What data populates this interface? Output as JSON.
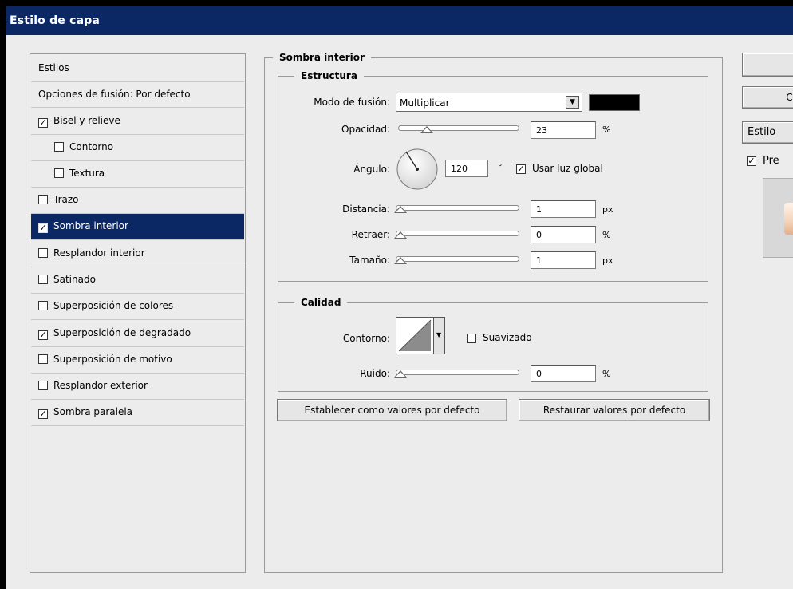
{
  "window": {
    "title": "Estilo de capa"
  },
  "sidebar": {
    "items": [
      {
        "label": "Estilos",
        "checkbox": false,
        "checked": false,
        "selected": false,
        "indent": false
      },
      {
        "label": "Opciones de fusión: Por defecto",
        "checkbox": false,
        "checked": false,
        "selected": false,
        "indent": false
      },
      {
        "label": "Bisel y relieve",
        "checkbox": true,
        "checked": true,
        "selected": false,
        "indent": false
      },
      {
        "label": "Contorno",
        "checkbox": true,
        "checked": false,
        "selected": false,
        "indent": true
      },
      {
        "label": "Textura",
        "checkbox": true,
        "checked": false,
        "selected": false,
        "indent": true
      },
      {
        "label": "Trazo",
        "checkbox": true,
        "checked": false,
        "selected": false,
        "indent": false
      },
      {
        "label": "Sombra interior",
        "checkbox": true,
        "checked": true,
        "selected": true,
        "indent": false
      },
      {
        "label": "Resplandor interior",
        "checkbox": true,
        "checked": false,
        "selected": false,
        "indent": false
      },
      {
        "label": "Satinado",
        "checkbox": true,
        "checked": false,
        "selected": false,
        "indent": false
      },
      {
        "label": "Superposición de colores",
        "checkbox": true,
        "checked": false,
        "selected": false,
        "indent": false
      },
      {
        "label": "Superposición de degradado",
        "checkbox": true,
        "checked": true,
        "selected": false,
        "indent": false
      },
      {
        "label": "Superposición de motivo",
        "checkbox": true,
        "checked": false,
        "selected": false,
        "indent": false
      },
      {
        "label": "Resplandor exterior",
        "checkbox": true,
        "checked": false,
        "selected": false,
        "indent": false
      },
      {
        "label": "Sombra paralela",
        "checkbox": true,
        "checked": true,
        "selected": false,
        "indent": false
      }
    ]
  },
  "panel": {
    "title": "Sombra interior",
    "structure": {
      "title": "Estructura",
      "blend_mode_label": "Modo de fusión:",
      "blend_mode_value": "Multiplicar",
      "shadow_color": "#000000",
      "opacity_label": "Opacidad:",
      "opacity_value": "23",
      "opacity_unit": "%",
      "opacity_level": 0.23,
      "angle_label": "Ángulo:",
      "angle_value": "120",
      "angle_unit": "°",
      "global_light_label": "Usar luz global",
      "global_light_checked": true,
      "distance_label": "Distancia:",
      "distance_value": "1",
      "distance_unit": "px",
      "choke_label": "Retraer:",
      "choke_value": "0",
      "choke_unit": "%",
      "size_label": "Tamaño:",
      "size_value": "1",
      "size_unit": "px"
    },
    "quality": {
      "title": "Calidad",
      "contour_label": "Contorno:",
      "antialias_label": "Suavizado",
      "antialias_checked": false,
      "noise_label": "Ruido:",
      "noise_value": "0",
      "noise_unit": "%"
    },
    "set_default_label": "Establecer como valores por defecto",
    "reset_default_label": "Restaurar valores por defecto"
  },
  "right": {
    "ok_label": "",
    "cancel_label": "Ca",
    "new_style_label": "Estilo",
    "preview_label": "Pre",
    "preview_checked": true
  },
  "icons": {
    "checkmark": "check-icon",
    "dropdown": "chevron-down-icon",
    "angle": "angle-dial-icon",
    "contour": "contour-curve-icon"
  }
}
